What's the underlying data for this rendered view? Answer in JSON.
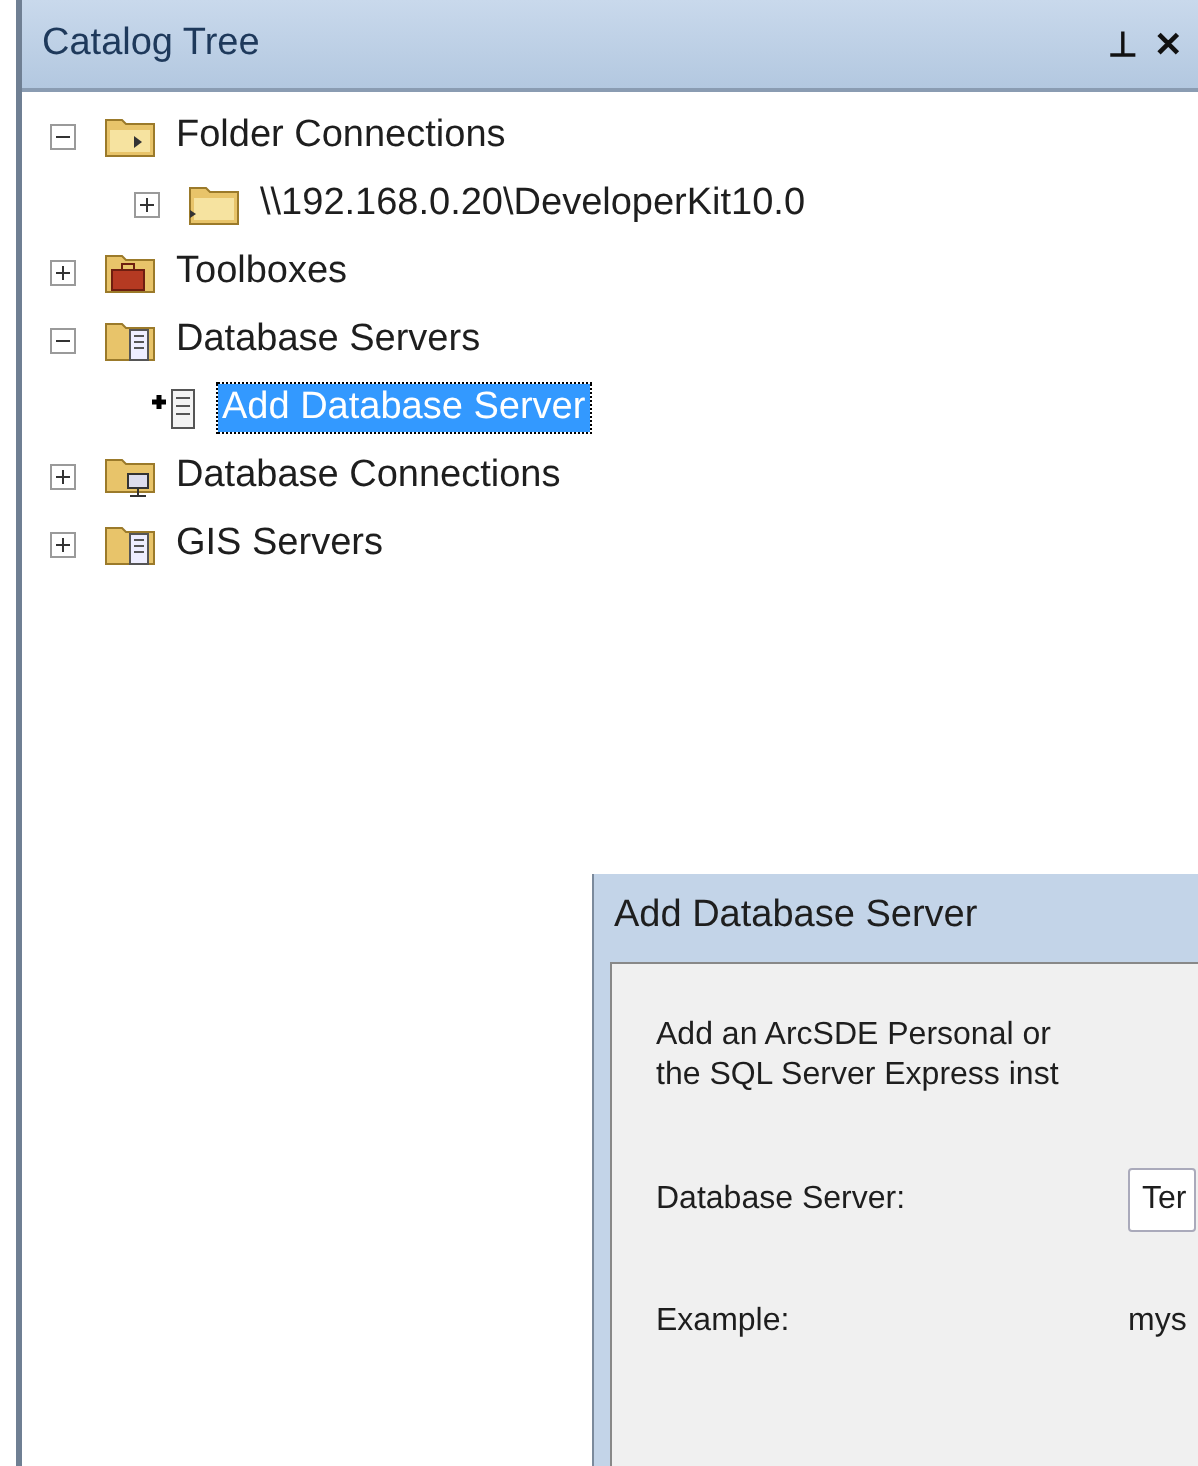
{
  "panel": {
    "title": "Catalog Tree",
    "pin": "⊥",
    "close": "✕"
  },
  "tree": [
    {
      "label": "Folder Connections",
      "kind": "folder-connections",
      "expanded": true,
      "selected": false,
      "children": [
        {
          "label": "\\\\192.168.0.20\\DeveloperKit10.0",
          "kind": "folder",
          "expanded": false,
          "selected": false
        }
      ]
    },
    {
      "label": "Toolboxes",
      "kind": "toolbox",
      "expanded": false,
      "selected": false
    },
    {
      "label": "Database Servers",
      "kind": "servers",
      "expanded": true,
      "selected": false,
      "children": [
        {
          "label": "Add Database Server",
          "kind": "add-server",
          "selected": true
        }
      ]
    },
    {
      "label": "Database Connections",
      "kind": "connections",
      "expanded": false,
      "selected": false
    },
    {
      "label": "GIS Servers",
      "kind": "servers",
      "expanded": false,
      "selected": false
    }
  ],
  "dialog": {
    "title": "Add Database Server",
    "description": [
      "Add an ArcSDE Personal or",
      "the SQL Server Express inst"
    ],
    "fields": [
      {
        "label": "Database Server:",
        "value": "Ter",
        "kind": "input"
      },
      {
        "label": "Example:",
        "value": "mys",
        "kind": "text"
      }
    ]
  }
}
